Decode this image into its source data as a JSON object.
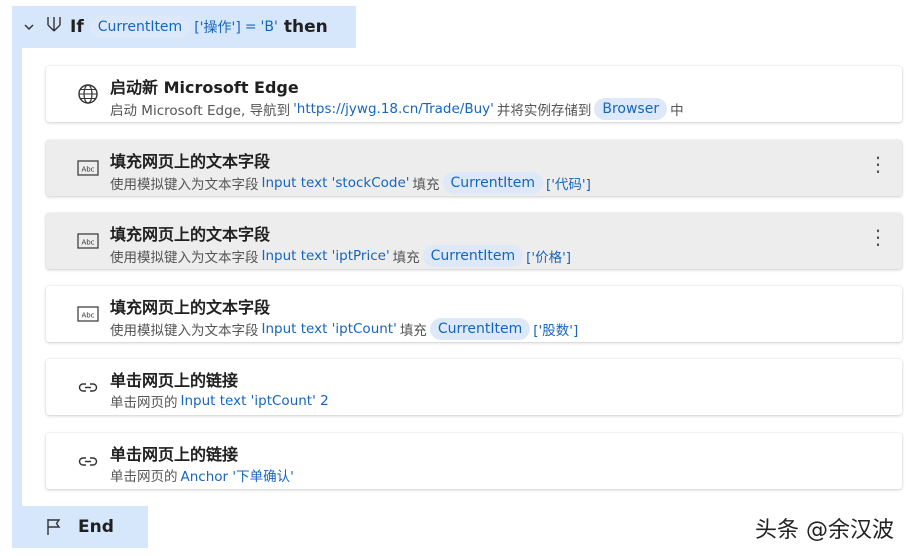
{
  "if_block": {
    "keyword_if": "If",
    "variable": "CurrentItem",
    "index": "['操作']",
    "operator": "=",
    "value": "'B'",
    "keyword_then": "then"
  },
  "actions": [
    {
      "icon": "globe-icon",
      "title": "启动新 Microsoft Edge",
      "desc_prefix": "启动 Microsoft Edge,  导航到",
      "desc_link": "'https://jywg.18.cn/Trade/Buy'",
      "desc_mid": "并将实例存储到",
      "desc_var": "Browser",
      "desc_suffix": "中"
    },
    {
      "icon": "text-field-icon",
      "title": "填充网页上的文本字段",
      "desc_prefix": "使用模拟键入为文本字段",
      "desc_link": "Input text 'stockCode'",
      "desc_mid": "填充",
      "desc_var": "CurrentItem",
      "desc_suffix": "['代码']"
    },
    {
      "icon": "text-field-icon",
      "title": "填充网页上的文本字段",
      "desc_prefix": "使用模拟键入为文本字段",
      "desc_link": "Input text 'iptPrice'",
      "desc_mid": "填充",
      "desc_var": "CurrentItem",
      "desc_suffix": "['价格']"
    },
    {
      "icon": "text-field-icon",
      "title": "填充网页上的文本字段",
      "desc_prefix": "使用模拟键入为文本字段",
      "desc_link": "Input text 'iptCount'",
      "desc_mid": "填充",
      "desc_var": "CurrentItem",
      "desc_suffix": "['股数']"
    },
    {
      "icon": "link-icon",
      "title": "单击网页上的链接",
      "desc_prefix": "单击网页的",
      "desc_link": "Input text 'iptCount' 2"
    },
    {
      "icon": "link-icon",
      "title": "单击网页上的链接",
      "desc_prefix": "单击网页的",
      "desc_link": "Anchor '下单确认'"
    }
  ],
  "end_block": {
    "keyword": "End"
  },
  "more_menu_glyph": "⋮",
  "watermark": "头条 @余汉波",
  "colors": {
    "accent": "#1565c0",
    "block_bg": "#d6e6fb",
    "pill_bg": "#dde9f8",
    "selected_row": "#ededed"
  }
}
